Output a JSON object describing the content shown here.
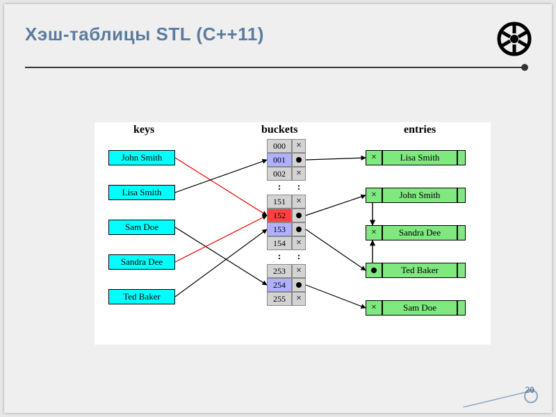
{
  "title": "Хэш-таблицы STL (C++11)",
  "page_number": "20",
  "columns": {
    "keys": "keys",
    "buckets": "buckets",
    "entries": "entries"
  },
  "keys": [
    {
      "name": "John Smith"
    },
    {
      "name": "Lisa Smith"
    },
    {
      "name": "Sam Doe"
    },
    {
      "name": "Sandra Dee"
    },
    {
      "name": "Ted Baker"
    }
  ],
  "buckets": [
    {
      "index": "000",
      "color": "#d3d3d3",
      "ptr": "x"
    },
    {
      "index": "001",
      "color": "#b0b0ff",
      "ptr": "dot"
    },
    {
      "index": "002",
      "color": "#d3d3d3",
      "ptr": "x"
    },
    {
      "index": "151",
      "color": "#d3d3d3",
      "ptr": "x"
    },
    {
      "index": "152",
      "color": "#ff4040",
      "ptr": "dot"
    },
    {
      "index": "153",
      "color": "#b0b0ff",
      "ptr": "dot"
    },
    {
      "index": "154",
      "color": "#d3d3d3",
      "ptr": "x"
    },
    {
      "index": "253",
      "color": "#d3d3d3",
      "ptr": "x"
    },
    {
      "index": "254",
      "color": "#b0b0ff",
      "ptr": "dot"
    },
    {
      "index": "255",
      "color": "#d3d3d3",
      "ptr": "x"
    }
  ],
  "entries": [
    {
      "prev": "x",
      "name": "Lisa Smith"
    },
    {
      "prev": "x",
      "name": "John Smith"
    },
    {
      "prev": "x",
      "name": "Sandra Dee"
    },
    {
      "prev": "dot",
      "name": "Ted Baker"
    },
    {
      "prev": "x",
      "name": "Sam Doe"
    }
  ],
  "hash_map": {
    "John Smith": "152",
    "Lisa Smith": "001",
    "Sam Doe": "254",
    "Sandra Dee": "152",
    "Ted Baker": "153"
  }
}
